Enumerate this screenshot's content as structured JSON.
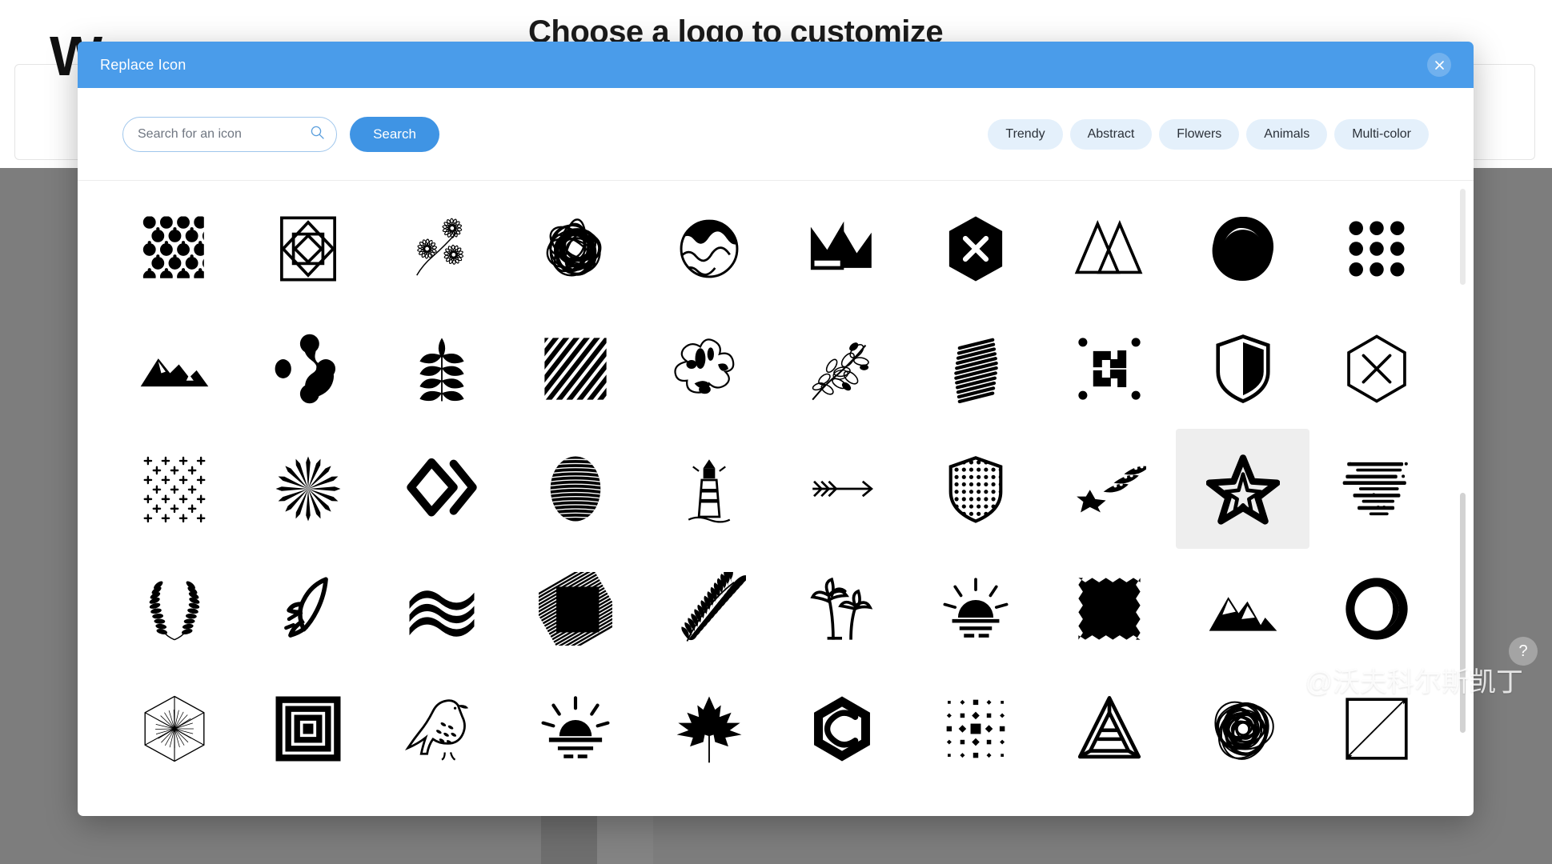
{
  "background": {
    "headline": "Choose a logo to customize",
    "big_letter": "W"
  },
  "modal": {
    "title": "Replace Icon",
    "close_label": "×",
    "close_icon": "close-icon"
  },
  "toolbar": {
    "search": {
      "placeholder": "Search for an icon",
      "value": "",
      "icon": "search-icon"
    },
    "search_button_label": "Search",
    "chips": [
      {
        "label": "Trendy"
      },
      {
        "label": "Abstract"
      },
      {
        "label": "Flowers"
      },
      {
        "label": "Animals"
      },
      {
        "label": "Multi-color"
      }
    ]
  },
  "colors": {
    "titlebar": "#4a9cea",
    "primary_button": "#3f94e4",
    "chip_bg": "#e4f0fb",
    "chip_text": "#2b3139",
    "selected_cell_bg": "#eeeeee",
    "overlay_dim": "#7d7d7d",
    "icon_black": "#000000"
  },
  "grid": {
    "columns": 10,
    "rows": 5,
    "selected_index": 28,
    "icons": [
      {
        "index": 0,
        "name": "polka-dot-pattern-icon",
        "shape": "dots-pattern"
      },
      {
        "index": 1,
        "name": "nested-squares-icon",
        "shape": "nested-geometry"
      },
      {
        "index": 2,
        "name": "leaf-sprig-outline-icon",
        "shape": "botanical-sprig"
      },
      {
        "index": 3,
        "name": "scribble-blob-icon",
        "shape": "scribble-blob"
      },
      {
        "index": 4,
        "name": "circle-landscape-icon",
        "shape": "circle-wave"
      },
      {
        "index": 5,
        "name": "crown-icon",
        "shape": "crown"
      },
      {
        "index": 6,
        "name": "hexagon-x-filled-icon",
        "shape": "hex-x-filled"
      },
      {
        "index": 7,
        "name": "double-triangle-icon",
        "shape": "double-triangle"
      },
      {
        "index": 8,
        "name": "wax-seal-blob-icon",
        "shape": "wax-seal"
      },
      {
        "index": 9,
        "name": "dot-grid-3x3-icon",
        "shape": "dot-grid"
      },
      {
        "index": 10,
        "name": "mountain-range-icon",
        "shape": "mountain-solid"
      },
      {
        "index": 11,
        "name": "molecule-blob-icon",
        "shape": "molecule-blob"
      },
      {
        "index": 12,
        "name": "fern-leaf-icon",
        "shape": "fern-leaf"
      },
      {
        "index": 13,
        "name": "diagonal-stripes-icon",
        "shape": "diagonal-stripes"
      },
      {
        "index": 14,
        "name": "ink-splatter-icon",
        "shape": "ink-splatter"
      },
      {
        "index": 15,
        "name": "botanical-branch-icon",
        "shape": "botanical-branch"
      },
      {
        "index": 16,
        "name": "scribble-hatch-icon",
        "shape": "scribble-hatch"
      },
      {
        "index": 17,
        "name": "geometric-arrows-icon",
        "shape": "geo-arrows"
      },
      {
        "index": 18,
        "name": "shield-split-icon",
        "shape": "shield-split"
      },
      {
        "index": 19,
        "name": "hexagon-x-outline-icon",
        "shape": "hex-x-outline"
      },
      {
        "index": 20,
        "name": "plus-grid-icon",
        "shape": "plus-grid"
      },
      {
        "index": 21,
        "name": "starburst-flower-icon",
        "shape": "starburst"
      },
      {
        "index": 22,
        "name": "diamond-chevron-icon",
        "shape": "diamond-chevron"
      },
      {
        "index": 23,
        "name": "striped-sphere-icon",
        "shape": "striped-sphere"
      },
      {
        "index": 24,
        "name": "lighthouse-icon",
        "shape": "lighthouse"
      },
      {
        "index": 25,
        "name": "long-arrow-right-icon",
        "shape": "arrow-right"
      },
      {
        "index": 26,
        "name": "shield-dotted-icon",
        "shape": "shield-dotted"
      },
      {
        "index": 27,
        "name": "shooting-star-icon",
        "shape": "shooting-star"
      },
      {
        "index": 28,
        "name": "star-outline-icon",
        "shape": "star-hand"
      },
      {
        "index": 29,
        "name": "speed-lines-icon",
        "shape": "speed-lines"
      },
      {
        "index": 30,
        "name": "laurel-wreath-icon",
        "shape": "laurel-wreath"
      },
      {
        "index": 31,
        "name": "rocket-icon",
        "shape": "rocket"
      },
      {
        "index": 32,
        "name": "wave-lines-icon",
        "shape": "wave-lines"
      },
      {
        "index": 33,
        "name": "scribble-fill-icon",
        "shape": "scribble-fill"
      },
      {
        "index": 34,
        "name": "palm-frond-icon",
        "shape": "palm-frond"
      },
      {
        "index": 35,
        "name": "palm-trees-icon",
        "shape": "palm-trees"
      },
      {
        "index": 36,
        "name": "sunrise-icon",
        "shape": "sunrise"
      },
      {
        "index": 37,
        "name": "zigzag-square-icon",
        "shape": "zigzag-square"
      },
      {
        "index": 38,
        "name": "mountain-peaks-icon",
        "shape": "mountain-peaks"
      },
      {
        "index": 39,
        "name": "circle-crescent-icon",
        "shape": "circle-crescent"
      },
      {
        "index": 40,
        "name": "hexagon-rays-icon",
        "shape": "hexagon-rays"
      },
      {
        "index": 41,
        "name": "concentric-squares-icon",
        "shape": "concentric-squares"
      },
      {
        "index": 42,
        "name": "eagle-icon",
        "shape": "eagle"
      },
      {
        "index": 43,
        "name": "sunset-icon",
        "shape": "sunset"
      },
      {
        "index": 44,
        "name": "maple-leaf-icon",
        "shape": "maple-leaf"
      },
      {
        "index": 45,
        "name": "hexagon-c-monogram-icon",
        "shape": "hex-c"
      },
      {
        "index": 46,
        "name": "dot-matrix-icon",
        "shape": "dot-matrix"
      },
      {
        "index": 47,
        "name": "impossible-triangle-icon",
        "shape": "impossible-triangle"
      },
      {
        "index": 48,
        "name": "scribble-circle-icon",
        "shape": "scribble-circle"
      },
      {
        "index": 49,
        "name": "square-diagonal-icon",
        "shape": "square-diagonal"
      }
    ]
  },
  "watermark": {
    "handle": "@沃夫科尔斯凯丁",
    "logo": "weibo-logo"
  },
  "help": {
    "label": "?"
  }
}
